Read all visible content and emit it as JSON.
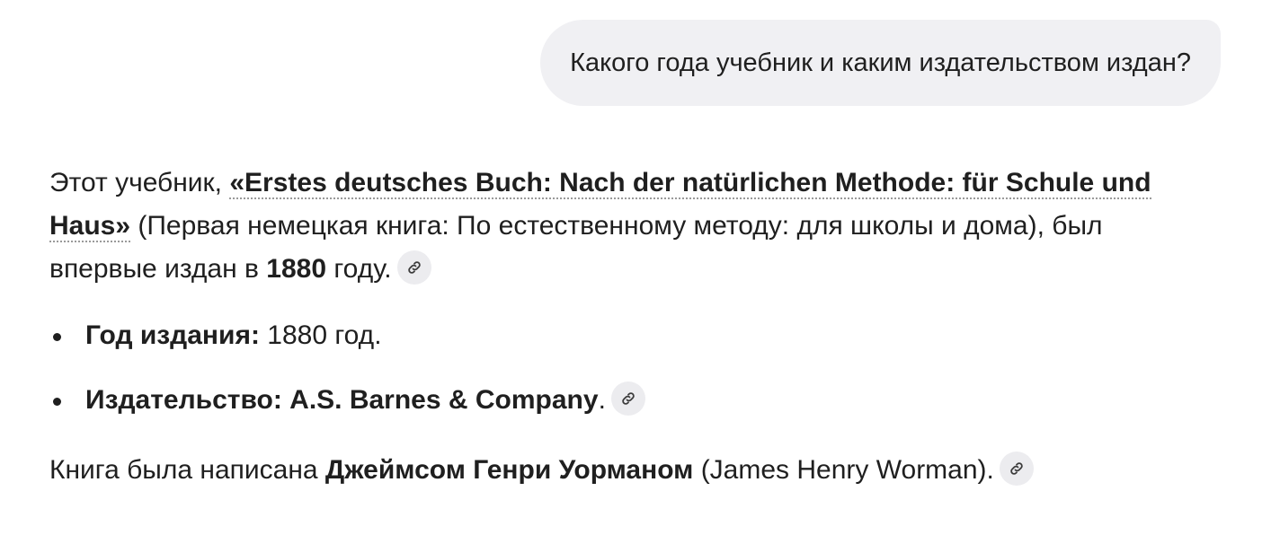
{
  "user_message": "Какого года учебник и каким издательством издан?",
  "answer": {
    "intro_prefix": "Этот учебник, ",
    "book_title": "«Erstes deutsches Buch: Nach der natürlichen Methode: für Schule und Haus»",
    "translation": " (Первая немецкая книга: По естественному методу: для школы и дома),",
    "first_published_prefix": " был впервые издан в ",
    "year": "1880",
    "first_published_suffix": " году.",
    "facts": [
      {
        "label": "Год издания:",
        "value": " 1880 год."
      },
      {
        "label": "Издательство: A.S. Barnes & Company",
        "value": "."
      }
    ],
    "author_prefix": "Книга была написана ",
    "author_name": "Джеймсом Генри Уорманом",
    "author_suffix": " (James Henry Worman).",
    "citation_icon": "link-icon"
  }
}
